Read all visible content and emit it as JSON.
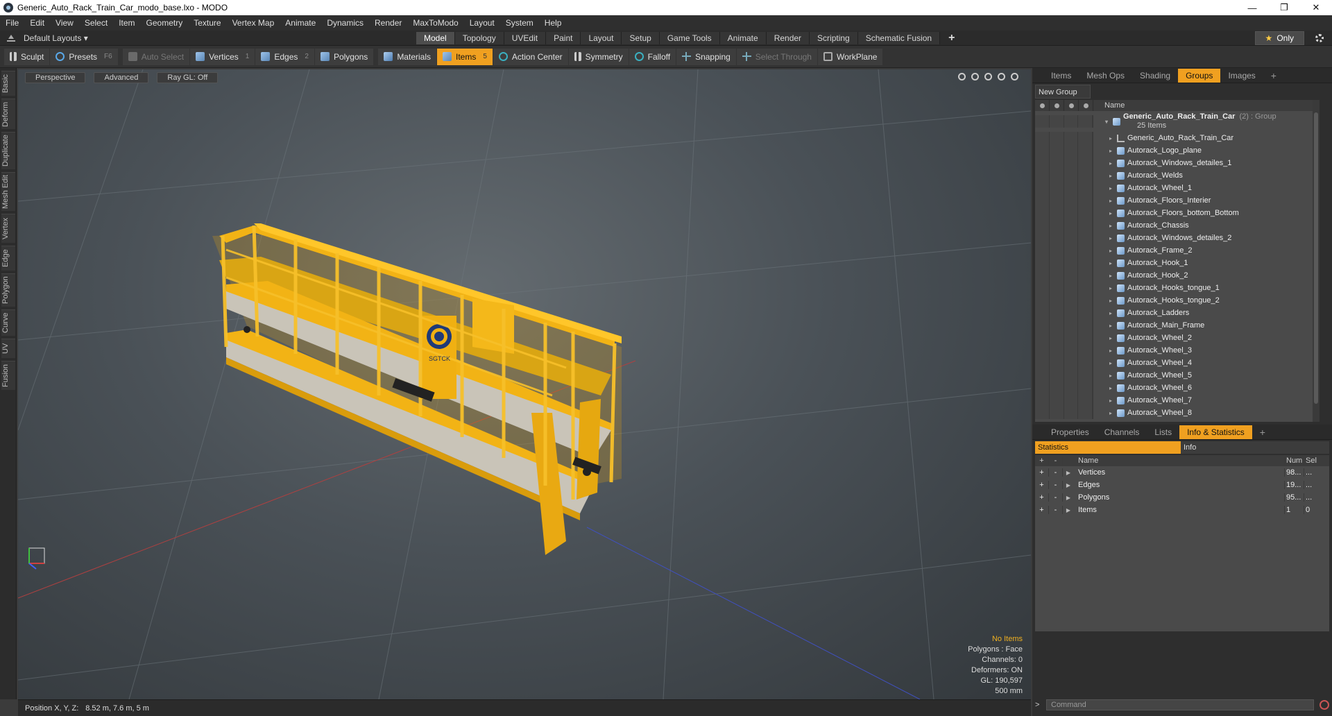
{
  "window": {
    "title": "Generic_Auto_Rack_Train_Car_modo_base.lxo - MODO",
    "minimize": "—",
    "maximize": "❐",
    "close": "✕"
  },
  "menu": [
    "File",
    "Edit",
    "View",
    "Select",
    "Item",
    "Geometry",
    "Texture",
    "Vertex Map",
    "Animate",
    "Dynamics",
    "Render",
    "MaxToModo",
    "Layout",
    "System",
    "Help"
  ],
  "layout": {
    "selector": "Default Layouts ▾",
    "tabs": [
      "Model",
      "Topology",
      "UVEdit",
      "Paint",
      "Layout",
      "Setup",
      "Game Tools",
      "Animate",
      "Render",
      "Scripting",
      "Schematic Fusion"
    ],
    "active_tab": "Model",
    "add": "+",
    "only_star": "★",
    "only": "Only"
  },
  "toolbar": {
    "sculpt": "Sculpt",
    "presets": "Presets",
    "presets_key": "F6",
    "auto_select": "Auto Select",
    "vertices": "Vertices",
    "vertices_count": "1",
    "edges": "Edges",
    "edges_count": "2",
    "polygons": "Polygons",
    "materials": "Materials",
    "items": "Items",
    "items_count": "5",
    "action_center": "Action Center",
    "symmetry": "Symmetry",
    "falloff": "Falloff",
    "snapping": "Snapping",
    "select_through": "Select Through",
    "workplane": "WorkPlane"
  },
  "left_tabs": [
    "Basic",
    "Deform",
    "Duplicate",
    "Mesh Edit",
    "Vertex",
    "Edge",
    "Polygon",
    "Curve",
    "UV",
    "Fusion"
  ],
  "viewport": {
    "perspective": "Perspective",
    "advanced": "Advanced",
    "raygl": "Ray GL: Off",
    "info": {
      "no_items": "No Items",
      "polygons": "Polygons : Face",
      "channels": "Channels: 0",
      "deformers": "Deformers: ON",
      "gl": "GL: 190,597",
      "scale": "500 mm"
    },
    "logo_text": "SGTCK"
  },
  "status": {
    "label": "Position X, Y, Z:",
    "value": "8.52 m, 7.6 m, 5 m"
  },
  "right_tabs_top": [
    "Items",
    "Mesh Ops",
    "Shading",
    "Groups",
    "Images"
  ],
  "right_tabs_top_active": "Groups",
  "new_group": "New Group",
  "groups_header": {
    "name": "Name"
  },
  "group_root": {
    "name": "Generic_Auto_Rack_Train_Car",
    "count": "(2)",
    "type": ": Group",
    "sub": "25 Items"
  },
  "group_items": [
    {
      "name": "Generic_Auto_Rack_Train_Car",
      "kind": "locator"
    },
    {
      "name": "Autorack_Logo_plane",
      "kind": "mesh"
    },
    {
      "name": "Autorack_Windows_detailes_1",
      "kind": "mesh"
    },
    {
      "name": "Autorack_Welds",
      "kind": "mesh"
    },
    {
      "name": "Autorack_Wheel_1",
      "kind": "mesh"
    },
    {
      "name": "Autorack_Floors_Interier",
      "kind": "mesh"
    },
    {
      "name": "Autorack_Floors_bottom_Bottom",
      "kind": "mesh"
    },
    {
      "name": "Autorack_Chassis",
      "kind": "mesh"
    },
    {
      "name": "Autorack_Windows_detailes_2",
      "kind": "mesh"
    },
    {
      "name": "Autorack_Frame_2",
      "kind": "mesh"
    },
    {
      "name": "Autorack_Hook_1",
      "kind": "mesh"
    },
    {
      "name": "Autorack_Hook_2",
      "kind": "mesh"
    },
    {
      "name": "Autorack_Hooks_tongue_1",
      "kind": "mesh"
    },
    {
      "name": "Autorack_Hooks_tongue_2",
      "kind": "mesh"
    },
    {
      "name": "Autorack_Ladders",
      "kind": "mesh"
    },
    {
      "name": "Autorack_Main_Frame",
      "kind": "mesh"
    },
    {
      "name": "Autorack_Wheel_2",
      "kind": "mesh"
    },
    {
      "name": "Autorack_Wheel_3",
      "kind": "mesh"
    },
    {
      "name": "Autorack_Wheel_4",
      "kind": "mesh"
    },
    {
      "name": "Autorack_Wheel_5",
      "kind": "mesh"
    },
    {
      "name": "Autorack_Wheel_6",
      "kind": "mesh"
    },
    {
      "name": "Autorack_Wheel_7",
      "kind": "mesh"
    },
    {
      "name": "Autorack_Wheel_8",
      "kind": "mesh"
    }
  ],
  "right_tabs_bottom": [
    "Properties",
    "Channels",
    "Lists",
    "Info & Statistics"
  ],
  "right_tabs_bottom_active": "Info & Statistics",
  "stats_tabs": {
    "statistics": "Statistics",
    "info": "Info"
  },
  "stats_header": {
    "name": "Name",
    "num": "Num",
    "sel": "Sel"
  },
  "stats_rows": [
    {
      "name": "Vertices",
      "num": "98...",
      "sel": "..."
    },
    {
      "name": "Edges",
      "num": "19...",
      "sel": "..."
    },
    {
      "name": "Polygons",
      "num": "95...",
      "sel": "..."
    },
    {
      "name": "Items",
      "num": "1",
      "sel": "0"
    }
  ],
  "command": {
    "prompt": ">",
    "placeholder": "Command"
  },
  "colors": {
    "accent": "#f0a020",
    "model_yellow": "#f2b315",
    "panel": "#4a4a4a"
  }
}
